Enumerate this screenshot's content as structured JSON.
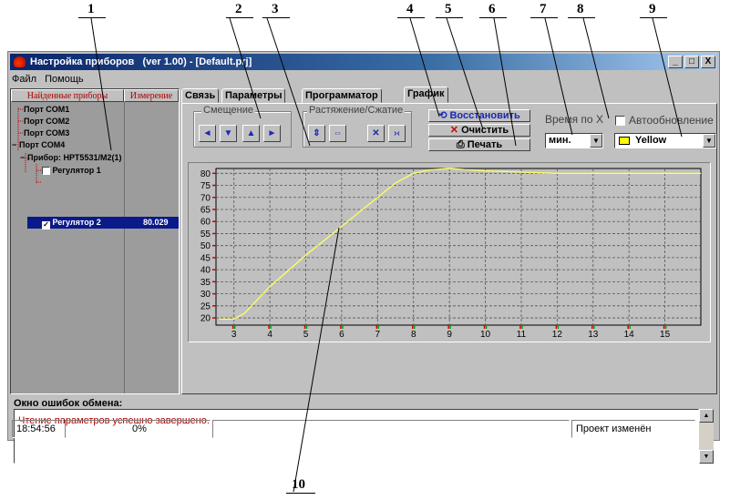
{
  "callouts": [
    "1",
    "2",
    "3",
    "4",
    "5",
    "6",
    "7",
    "8",
    "9",
    "10"
  ],
  "window": {
    "title": "Настройка приборов   (ver 1.00) - [Default.prj]",
    "controls": [
      "_",
      "□",
      "X"
    ]
  },
  "menu": [
    "Файл",
    "Помощь"
  ],
  "device_tree": {
    "headers": [
      "Найденные приборы",
      "Измерение"
    ],
    "items": [
      {
        "label": "Порт COM1"
      },
      {
        "label": "Порт COM2"
      },
      {
        "label": "Порт COM3"
      },
      {
        "label": "Порт COM4"
      },
      {
        "label": "Прибор: НРТ5531/М2(1)"
      },
      {
        "label": "Регулятор 1"
      },
      {
        "label": "Регулятор 2",
        "value": "80.029"
      }
    ]
  },
  "tabs": [
    "Связь",
    "Параметры",
    "Программатор",
    "График"
  ],
  "offset_group": {
    "title": "Смещение",
    "buttons": [
      "◄",
      "▼",
      "▲",
      "►"
    ]
  },
  "scale_group": {
    "title": "Растяжение/Сжатие",
    "buttons": [
      "⇕",
      "⇔",
      "✕",
      "›‹"
    ]
  },
  "actions": {
    "restore": "Восстановить",
    "clear": "Очистить",
    "print": "Печать"
  },
  "time_axis": {
    "label": "Время по X",
    "value": "мин."
  },
  "auto_update": {
    "label": "Автообновление",
    "checked": false
  },
  "color_select": {
    "value": "Yellow",
    "swatch": "#ffff00"
  },
  "chart_data": {
    "type": "line",
    "xlim": [
      2.5,
      16
    ],
    "ylim": [
      17,
      82
    ],
    "xticks": [
      3,
      4,
      5,
      6,
      7,
      8,
      9,
      10,
      11,
      12,
      13,
      14,
      15
    ],
    "yticks": [
      20,
      25,
      30,
      35,
      40,
      45,
      50,
      55,
      60,
      65,
      70,
      75,
      80
    ],
    "grid": true,
    "background": "#c0c0c0",
    "series": [
      {
        "color": "#ffff60",
        "x": [
          2.6,
          3.0,
          3.3,
          4.0,
          5.0,
          6.0,
          7.0,
          7.5,
          8.0,
          8.5,
          9.0,
          10.0,
          11.0,
          12.0,
          13.0,
          14.0,
          15.0,
          16.0
        ],
        "y": [
          19.5,
          19.5,
          22,
          33,
          46,
          58,
          70,
          76,
          80,
          81.5,
          82,
          81,
          80.5,
          80,
          80,
          80,
          80,
          80
        ]
      }
    ]
  },
  "error_window": {
    "label": "Окно ошибок обмена:",
    "message": "Чтение параметров успешно завершено."
  },
  "status": {
    "time": "18:54:56",
    "progress": "0%",
    "message": "Проект изменён"
  }
}
